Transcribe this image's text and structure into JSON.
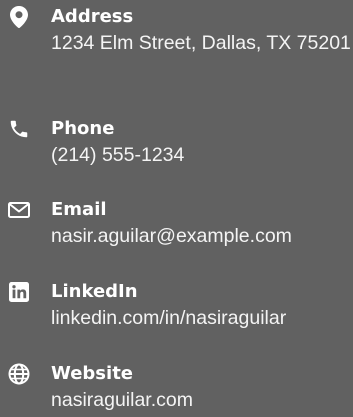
{
  "contacts": [
    {
      "icon": "map-marker-icon",
      "label": "Address",
      "value": "1234 Elm Street, Dallas, TX 75201"
    },
    {
      "icon": "phone-icon",
      "label": "Phone",
      "value": "(214) 555-1234"
    },
    {
      "icon": "envelope-icon",
      "label": "Email",
      "value": "nasir.aguilar@example.com"
    },
    {
      "icon": "linkedin-icon",
      "label": "LinkedIn",
      "value": "linkedin.com/in/nasiraguilar"
    },
    {
      "icon": "globe-icon",
      "label": "Website",
      "value": "nasiraguilar.com"
    }
  ],
  "colors": {
    "background": "#616161",
    "text": "#ffffff"
  }
}
